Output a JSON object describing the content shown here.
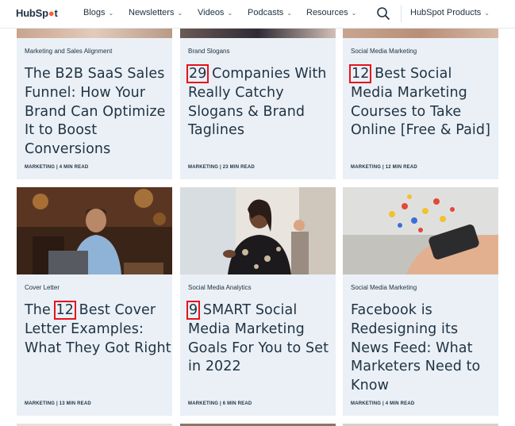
{
  "nav": {
    "logo_a": "Hub",
    "logo_b": "Sp",
    "logo_c": "t",
    "items": [
      "Blogs",
      "Newsletters",
      "Videos",
      "Podcasts",
      "Resources"
    ],
    "products": "HubSpot Products"
  },
  "cards": [
    {
      "tag": "Marketing and Sales Alignment",
      "title_pre": "",
      "title_num": "",
      "title_rest": "The B2B SaaS Sales Funnel: How Your Brand Can Optimize It to Boost Conversions",
      "meta": "MARKETING | 4 MIN READ"
    },
    {
      "tag": "Brand Slogans",
      "title_pre": "",
      "title_num": "29",
      "title_rest": " Companies With Really Catchy Slogans & Brand Taglines",
      "meta": "MARKETING | 23 MIN READ"
    },
    {
      "tag": "Social Media Marketing",
      "title_pre": "",
      "title_num": "12",
      "title_rest": " Best Social Media Marketing Courses to Take Online [Free & Paid]",
      "meta": "MARKETING | 12 MIN READ"
    },
    {
      "tag": "Cover Letter",
      "title_pre": "The ",
      "title_num": "12",
      "title_rest": " Best Cover Letter Examples: What They Got Right",
      "meta": "MARKETING | 13 MIN READ"
    },
    {
      "tag": "Social Media Analytics",
      "title_pre": "",
      "title_num": "9",
      "title_rest": " SMART Social Media Marketing Goals For You to Set in 2022",
      "meta": "MARKETING | 6 MIN READ"
    },
    {
      "tag": "Social Media Marketing",
      "title_pre": "",
      "title_num": "",
      "title_rest": "Facebook is Redesigning its News Feed: What Marketers Need to Know",
      "meta": "MARKETING | 4 MIN READ"
    }
  ]
}
